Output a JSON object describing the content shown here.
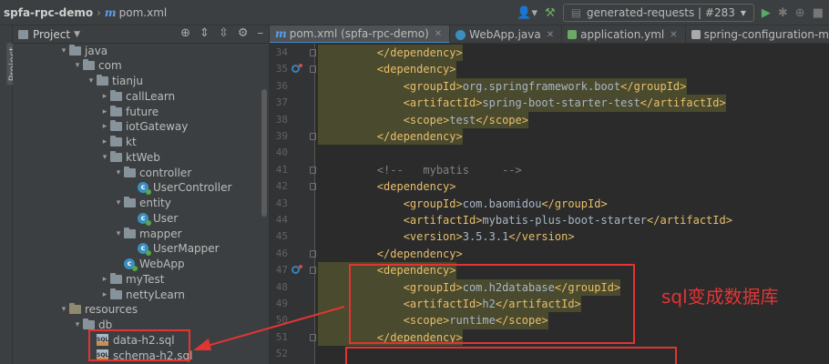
{
  "titlebar": {
    "project": "spfa-rpc-demo",
    "file": "pom.xml",
    "run_config": "generated-requests | #283"
  },
  "side_strip": {
    "label": "Project"
  },
  "project_panel": {
    "title": "Project",
    "tree": [
      {
        "label": "java",
        "depth": 0,
        "kind": "folder",
        "expanded": true
      },
      {
        "label": "com",
        "depth": 1,
        "kind": "folder",
        "expanded": true
      },
      {
        "label": "tianju",
        "depth": 2,
        "kind": "folder",
        "expanded": true
      },
      {
        "label": "callLearn",
        "depth": 3,
        "kind": "folder",
        "expanded": false
      },
      {
        "label": "future",
        "depth": 3,
        "kind": "folder",
        "expanded": false
      },
      {
        "label": "iotGateway",
        "depth": 3,
        "kind": "folder",
        "expanded": false
      },
      {
        "label": "kt",
        "depth": 3,
        "kind": "folder",
        "expanded": false
      },
      {
        "label": "ktWeb",
        "depth": 3,
        "kind": "folder",
        "expanded": true
      },
      {
        "label": "controller",
        "depth": 4,
        "kind": "folder",
        "expanded": true
      },
      {
        "label": "UserController",
        "depth": 5,
        "kind": "class"
      },
      {
        "label": "entity",
        "depth": 4,
        "kind": "folder",
        "expanded": true
      },
      {
        "label": "User",
        "depth": 5,
        "kind": "class"
      },
      {
        "label": "mapper",
        "depth": 4,
        "kind": "folder",
        "expanded": true
      },
      {
        "label": "UserMapper",
        "depth": 5,
        "kind": "class"
      },
      {
        "label": "WebApp",
        "depth": 4,
        "kind": "class"
      },
      {
        "label": "myTest",
        "depth": 3,
        "kind": "folder",
        "expanded": false
      },
      {
        "label": "nettyLearn",
        "depth": 3,
        "kind": "folder",
        "expanded": false
      },
      {
        "label": "resources",
        "depth": 0,
        "kind": "resfolder",
        "expanded": true
      },
      {
        "label": "db",
        "depth": 1,
        "kind": "folder",
        "expanded": true
      },
      {
        "label": "data-h2.sql",
        "depth": 2,
        "kind": "sql"
      },
      {
        "label": "schema-h2.sql",
        "depth": 2,
        "kind": "sql"
      }
    ]
  },
  "tabs": [
    {
      "label": "pom.xml (spfa-rpc-demo)",
      "icon": "m-icon",
      "active": true
    },
    {
      "label": "WebApp.java",
      "icon": "class-icon",
      "active": false
    },
    {
      "label": "application.yml",
      "icon": "yml-icon",
      "active": false
    },
    {
      "label": "spring-configuration-metadata.json",
      "icon": "json-icon",
      "active": false
    }
  ],
  "editor": {
    "lines": [
      {
        "n": "34",
        "indent": 8,
        "parts": [
          [
            "tag",
            "</dependency>"
          ]
        ],
        "hl": true
      },
      {
        "n": "35",
        "indent": 8,
        "parts": [
          [
            "tag",
            "<dependency>"
          ]
        ],
        "hl": true,
        "mark": true
      },
      {
        "n": "36",
        "indent": 12,
        "parts": [
          [
            "tag",
            "<groupId>"
          ],
          [
            "text",
            "org.springframework.boot"
          ],
          [
            "tag",
            "</groupId>"
          ]
        ],
        "hl": true
      },
      {
        "n": "37",
        "indent": 12,
        "parts": [
          [
            "tag",
            "<artifactId>"
          ],
          [
            "text",
            "spring-boot-starter-test"
          ],
          [
            "tag",
            "</artifactId>"
          ]
        ],
        "hl": true
      },
      {
        "n": "38",
        "indent": 12,
        "parts": [
          [
            "tag",
            "<scope>"
          ],
          [
            "text",
            "test"
          ],
          [
            "tag",
            "</scope>"
          ]
        ],
        "hl": true
      },
      {
        "n": "39",
        "indent": 8,
        "parts": [
          [
            "tag",
            "</dependency>"
          ]
        ],
        "hl": true
      },
      {
        "n": "40",
        "indent": 0,
        "parts": [],
        "hl": false
      },
      {
        "n": "41",
        "indent": 8,
        "parts": [
          [
            "cmt",
            "<!--   mybatis     -->"
          ]
        ],
        "hl": false
      },
      {
        "n": "42",
        "indent": 8,
        "parts": [
          [
            "tag",
            "<dependency>"
          ]
        ],
        "hl": false
      },
      {
        "n": "43",
        "indent": 12,
        "parts": [
          [
            "tag",
            "<groupId>"
          ],
          [
            "text",
            "com.baomidou"
          ],
          [
            "tag",
            "</groupId>"
          ]
        ],
        "hl": false
      },
      {
        "n": "44",
        "indent": 12,
        "parts": [
          [
            "tag",
            "<artifactId>"
          ],
          [
            "text",
            "mybatis-plus-boot-starter"
          ],
          [
            "tag",
            "</artifactId>"
          ]
        ],
        "hl": false
      },
      {
        "n": "45",
        "indent": 12,
        "parts": [
          [
            "tag",
            "<version>"
          ],
          [
            "text",
            "3.5.3.1"
          ],
          [
            "tag",
            "</version>"
          ]
        ],
        "hl": false
      },
      {
        "n": "46",
        "indent": 8,
        "parts": [
          [
            "tag",
            "</dependency>"
          ]
        ],
        "hl": false
      },
      {
        "n": "47",
        "indent": 8,
        "parts": [
          [
            "tag",
            "<dependency>"
          ]
        ],
        "hl": true,
        "mark": true
      },
      {
        "n": "48",
        "indent": 12,
        "parts": [
          [
            "tag",
            "<groupId>"
          ],
          [
            "text",
            "com.h2database"
          ],
          [
            "tag",
            "</groupId>"
          ]
        ],
        "hl": true
      },
      {
        "n": "49",
        "indent": 12,
        "parts": [
          [
            "tag",
            "<artifactId>"
          ],
          [
            "text",
            "h2"
          ],
          [
            "tag",
            "</artifactId>"
          ]
        ],
        "hl": true
      },
      {
        "n": "50",
        "indent": 12,
        "parts": [
          [
            "tag",
            "<scope>"
          ],
          [
            "text",
            "runtime"
          ],
          [
            "tag",
            "</scope>"
          ]
        ],
        "hl": true
      },
      {
        "n": "51",
        "indent": 8,
        "parts": [
          [
            "tag",
            "</dependency>"
          ]
        ],
        "hl": true
      },
      {
        "n": "52",
        "indent": 0,
        "parts": [],
        "hl": false
      }
    ]
  },
  "annotation": {
    "text": "sql变成数据库",
    "color": "#e33434"
  },
  "colors": {
    "xml_tag": "#e8bf6a",
    "text": "#a9b7c6",
    "comment": "#808080",
    "highlight": "#4a4a2e",
    "annotation_red": "#e33434"
  }
}
